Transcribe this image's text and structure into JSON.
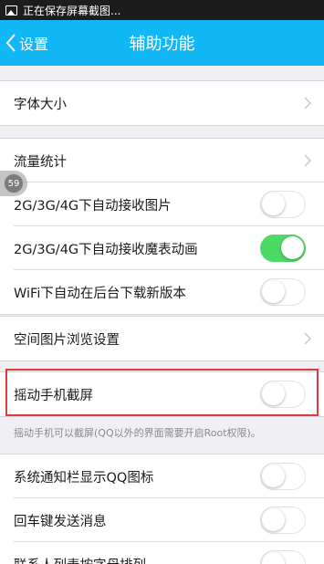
{
  "status_bar": {
    "text": "正在保存屏幕截图..."
  },
  "navbar": {
    "back_label": "设置",
    "title": "辅助功能"
  },
  "rows": {
    "font_size": "字体大小",
    "traffic": "流量统计",
    "auto_images": "2G/3G/4G下自动接收图片",
    "auto_magic": "2G/3G/4G下自动接收魔表动画",
    "wifi_update": "WiFi下自动在后台下载新版本",
    "album": "空间图片浏览设置",
    "shake": "摇动手机截屏",
    "notify_icon": "系统通知栏显示QQ图标",
    "enter_send": "回车键发送消息",
    "contacts_sort": "联系人列表按字母排列"
  },
  "shake_note": "摇动手机可以截屏(QQ以外的界面需要开启Root权限)。",
  "floating_badge": "59",
  "toggles": {
    "auto_images": false,
    "auto_magic": true,
    "wifi_update": false,
    "shake": false,
    "notify_icon": false,
    "enter_send": false,
    "contacts_sort": false
  },
  "colors": {
    "navbar": "#12b7f5",
    "toggle_on": "#4cd964",
    "highlight": "#e23a3a"
  }
}
